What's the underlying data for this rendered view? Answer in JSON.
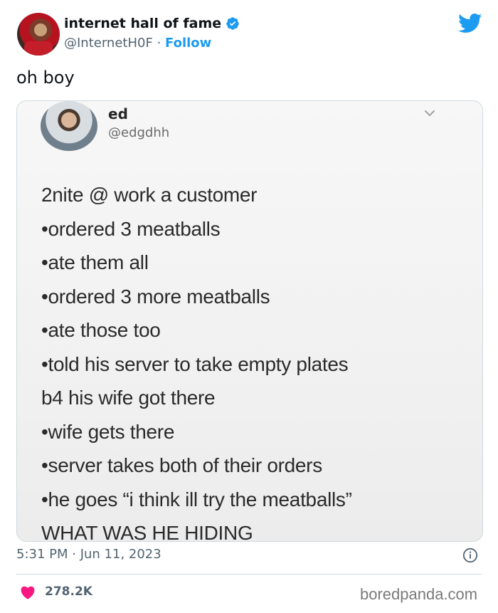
{
  "tweet": {
    "author_name": "internet hall of fame",
    "author_handle": "@InternetH0F",
    "separator": "·",
    "follow_label": "Follow",
    "text": "oh boy",
    "timestamp": "5:31 PM · Jun 11, 2023",
    "likes": "278.2K"
  },
  "embedded": {
    "name": "ed",
    "handle": "@edgdhh",
    "lines": [
      "2nite @ work a customer",
      "•ordered 3 meatballs",
      "•ate them all",
      "•ordered 3 more meatballs",
      "•ate those too",
      "•told his server to take empty plates",
      "b4 his wife got there",
      "•wife gets there",
      "•server takes both of their orders",
      "•he goes “i think ill try the meatballs”",
      "WHAT WAS HE HIDING"
    ]
  },
  "watermark": "boredpanda.com",
  "icons": {
    "verified": "verified-badge-icon",
    "logo": "twitter-bird-icon",
    "info": "info-icon",
    "heart": "heart-icon",
    "chevron": "chevron-down-icon"
  },
  "colors": {
    "accent": "#1d9bf0",
    "heart": "#f91880",
    "muted": "#536471",
    "border": "#cfd9de"
  }
}
